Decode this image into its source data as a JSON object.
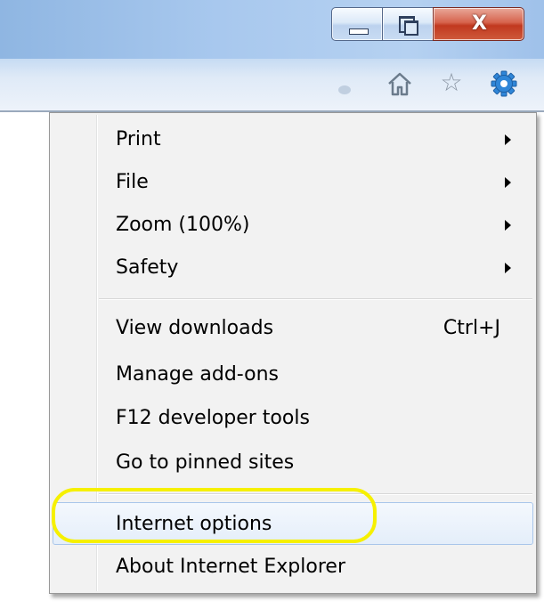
{
  "window_controls": {
    "minimize_icon": "minimize-icon",
    "maximize_icon": "restore-icon",
    "close_label": "X"
  },
  "toolbar": {
    "icons": [
      "home-icon",
      "star-icon",
      "gear-icon"
    ],
    "home_glyph": "⌂",
    "star_glyph": "☆",
    "gear_color": "#2f86d8"
  },
  "menu": {
    "items": [
      {
        "label": "Print",
        "submenu": true
      },
      {
        "label": "File",
        "submenu": true
      },
      {
        "label": "Zoom (100%)",
        "submenu": true
      },
      {
        "label": "Safety",
        "submenu": true
      },
      {
        "label": "View downloads",
        "shortcut": "Ctrl+J"
      },
      {
        "label": "Manage add-ons"
      },
      {
        "label": "F12 developer tools"
      },
      {
        "label": "Go to pinned sites"
      },
      {
        "label": "Internet options",
        "hovered": true
      },
      {
        "label": "About Internet Explorer"
      }
    ]
  },
  "annotation": {
    "color": "#f6f000",
    "target": "Internet options"
  }
}
